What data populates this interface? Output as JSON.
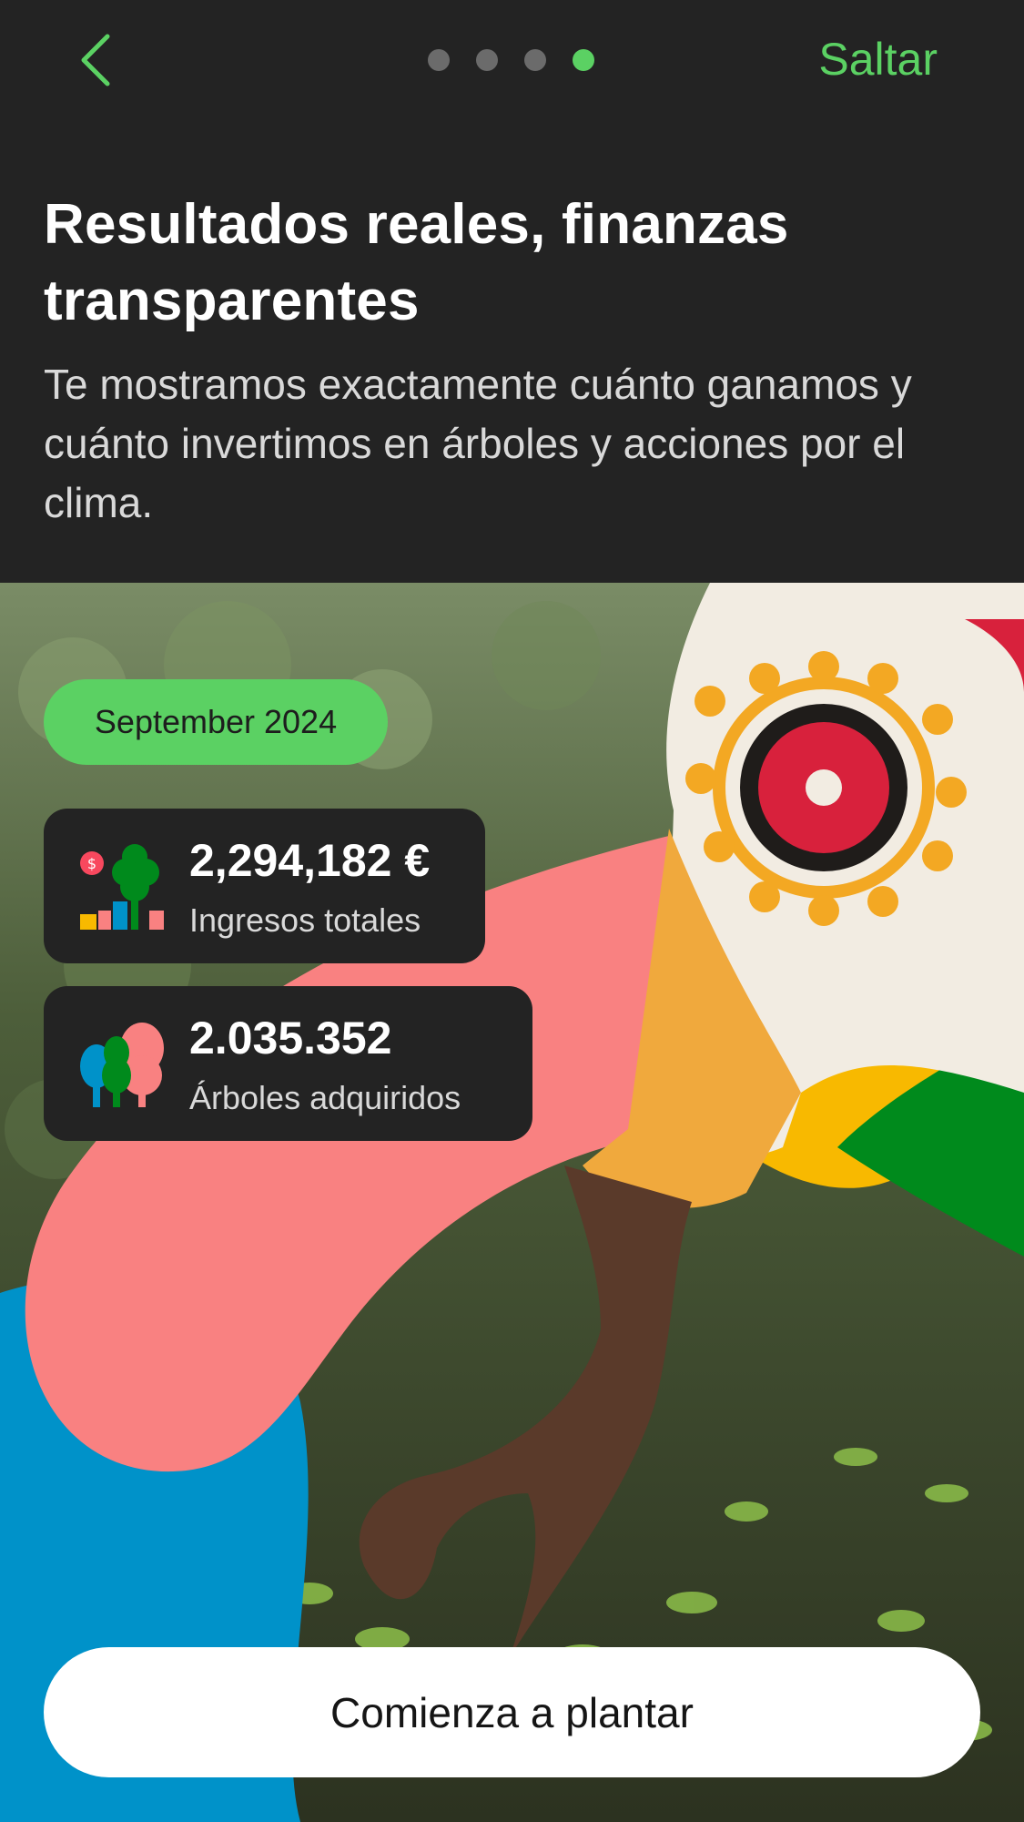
{
  "nav": {
    "back_icon": "chevron-left-icon",
    "pager": {
      "total": 4,
      "current": 4
    },
    "skip_label": "Saltar"
  },
  "header": {
    "title": "Resultados reales, finanzas transparentes",
    "subtitle": "Te mostramos exactamente cuánto ganamos y cuánto invertimos en árboles y acciones por el clima."
  },
  "stats": {
    "month": "September 2024",
    "revenue": {
      "value": "2,294,182 €",
      "label": "Ingresos totales",
      "icon": "revenue-chart-icon"
    },
    "trees": {
      "value": "2.035.352",
      "label": "Árboles adquiridos",
      "icon": "trees-icon"
    }
  },
  "cta": {
    "label": "Comienza a plantar"
  },
  "colors": {
    "background": "#232323",
    "accent_green": "#5bd163",
    "pink": "#f98181",
    "blue": "#0092c9",
    "yellow": "#f8b900",
    "dark_green": "#008a1c",
    "button_bg": "#ffffff"
  }
}
